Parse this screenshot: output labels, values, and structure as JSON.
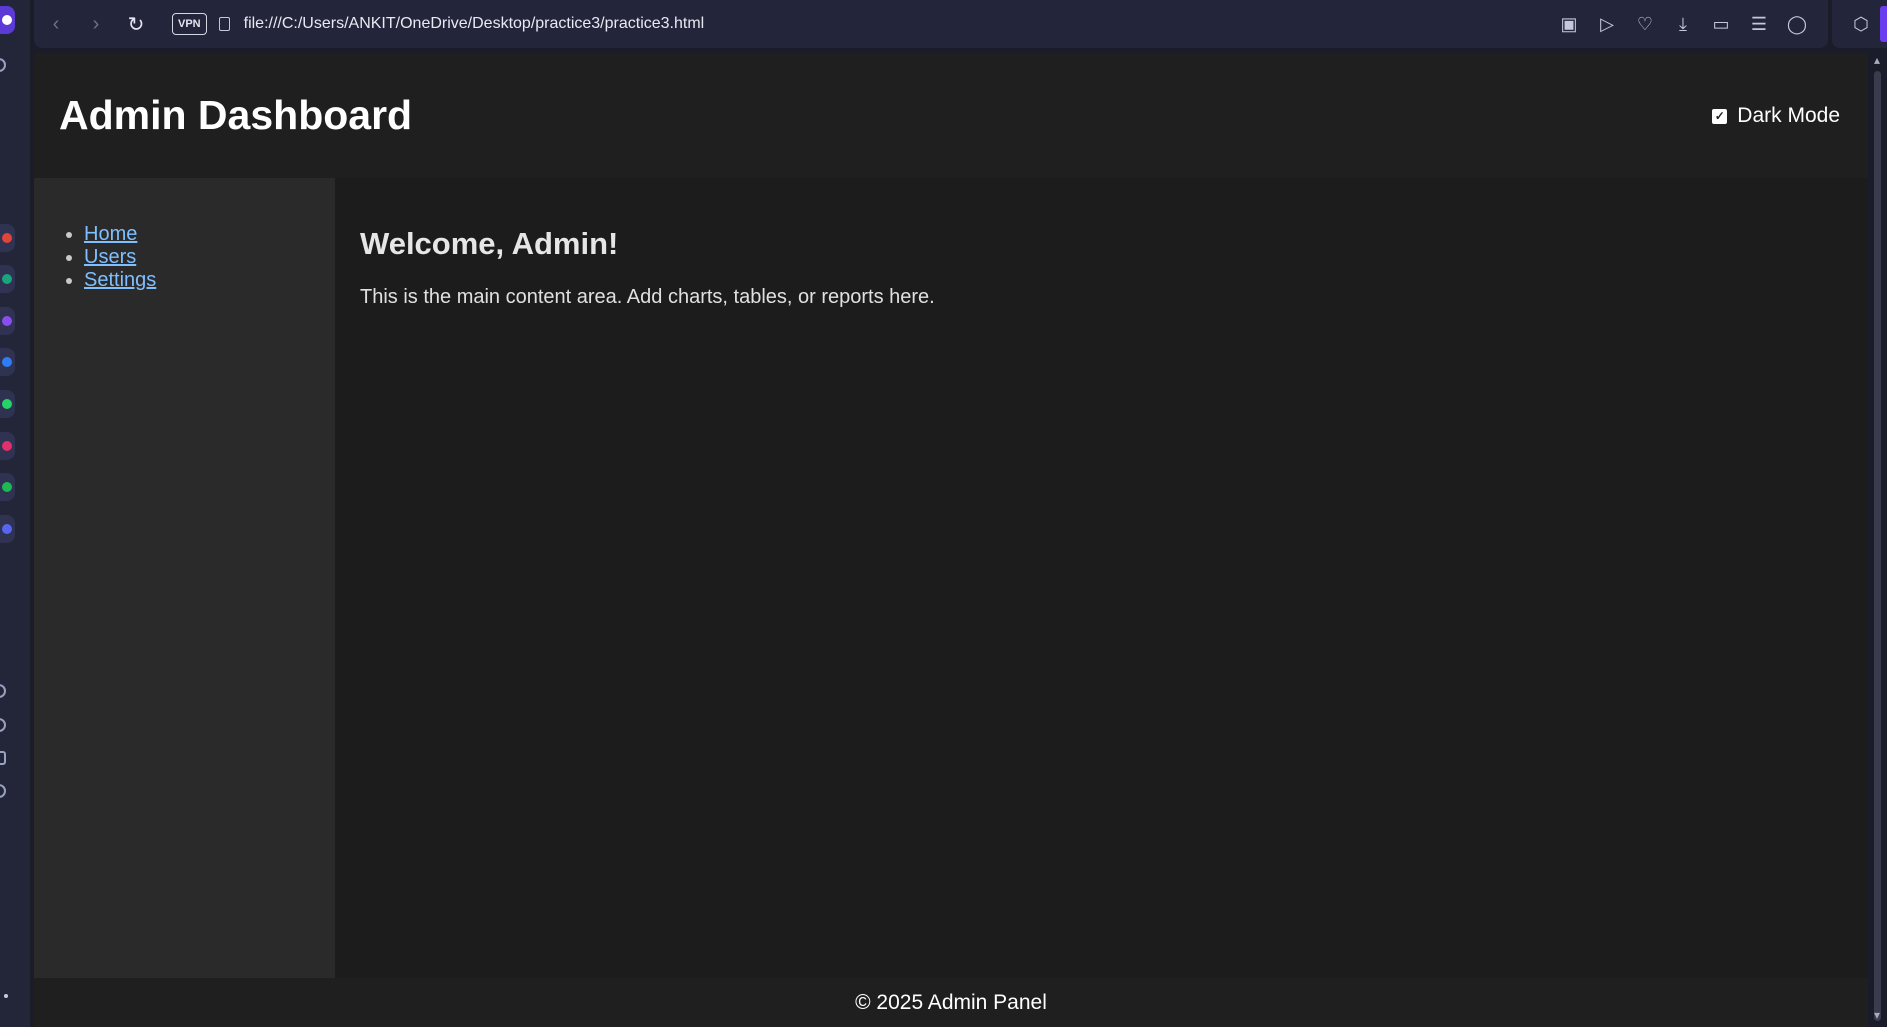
{
  "browser": {
    "url": "file:///C:/Users/ANKIT/OneDrive/Desktop/practice3/practice3.html",
    "vpn_label": "VPN",
    "nav_icons": [
      "back-icon",
      "forward-icon",
      "reload-icon"
    ],
    "toolbar_icons": [
      "camera-icon",
      "play-icon",
      "heart-icon",
      "download-icon",
      "battery-saver-icon",
      "easy-setup-icon",
      "profile-icon"
    ],
    "extension_icon": "cube-icon",
    "accent_color": "#6a3cf0"
  },
  "side_rail": {
    "apps": [
      {
        "icon": "app-red-icon",
        "color": "#e0453a"
      },
      {
        "icon": "chatgpt-icon",
        "color": "#19a37f"
      },
      {
        "icon": "app-purple-icon",
        "color": "#8a4df0"
      },
      {
        "icon": "messenger-icon",
        "color": "#2f7cf6"
      },
      {
        "icon": "whatsapp-icon",
        "color": "#25d366"
      },
      {
        "icon": "instagram-icon",
        "color": "#e1306c"
      },
      {
        "icon": "spotify-icon",
        "color": "#1db954"
      },
      {
        "icon": "app-blue-icon",
        "color": "#5865f2"
      }
    ]
  },
  "page": {
    "title": "Admin Dashboard",
    "dark_mode_label": "Dark Mode",
    "dark_mode_checked": true,
    "sidebar_links": [
      "Home",
      "Users",
      "Settings"
    ],
    "main_heading": "Welcome, Admin!",
    "main_text": "This is the main content area. Add charts, tables, or reports here.",
    "footer_text": "© 2025 Admin Panel",
    "colors": {
      "header_bg": "#1f1f1f",
      "sidebar_bg": "#2a2a2a",
      "main_bg": "#1c1c1c",
      "link": "#7fbfff"
    }
  }
}
